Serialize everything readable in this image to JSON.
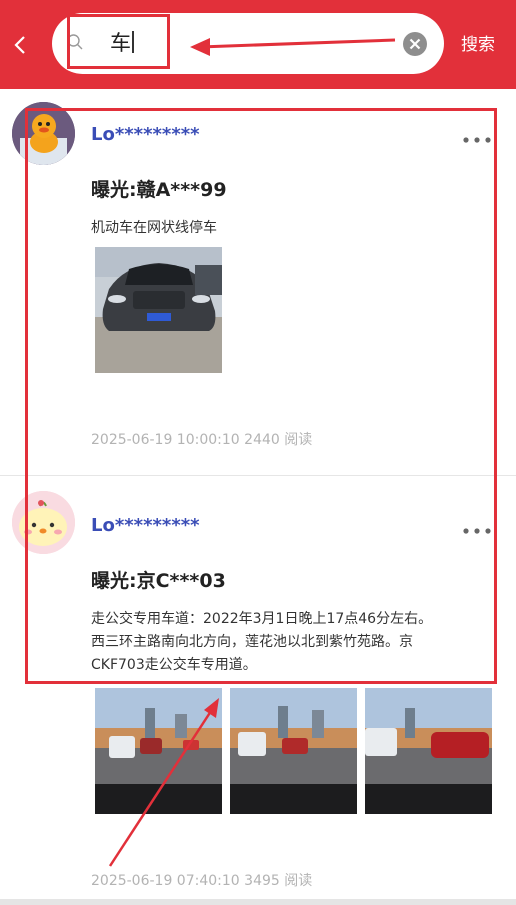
{
  "search": {
    "query": "车",
    "button_label": "搜索"
  },
  "posts": [
    {
      "username": "Lo*********",
      "title": "曝光:赣A***99",
      "desc_lines": [
        "机动车在网状线停车"
      ],
      "timestamp": "2025-06-19 10:00:10",
      "views": "2440",
      "views_unit": "阅读"
    },
    {
      "username": "Lo*********",
      "title": "曝光:京C***03",
      "desc_lines": [
        "走公交专用车道：2022年3月1日晚上17点46分左右。",
        "西三环主路南向北方向，莲花池以北到紫竹苑路。京",
        "CKF703走公交车专用道。"
      ],
      "timestamp": "2025-06-19 07:40:10",
      "views": "3495",
      "views_unit": "阅读"
    }
  ],
  "colors": {
    "brand_red": "#e2303a",
    "username_blue": "#3a4db6",
    "meta_gray": "#b3b3b3"
  }
}
